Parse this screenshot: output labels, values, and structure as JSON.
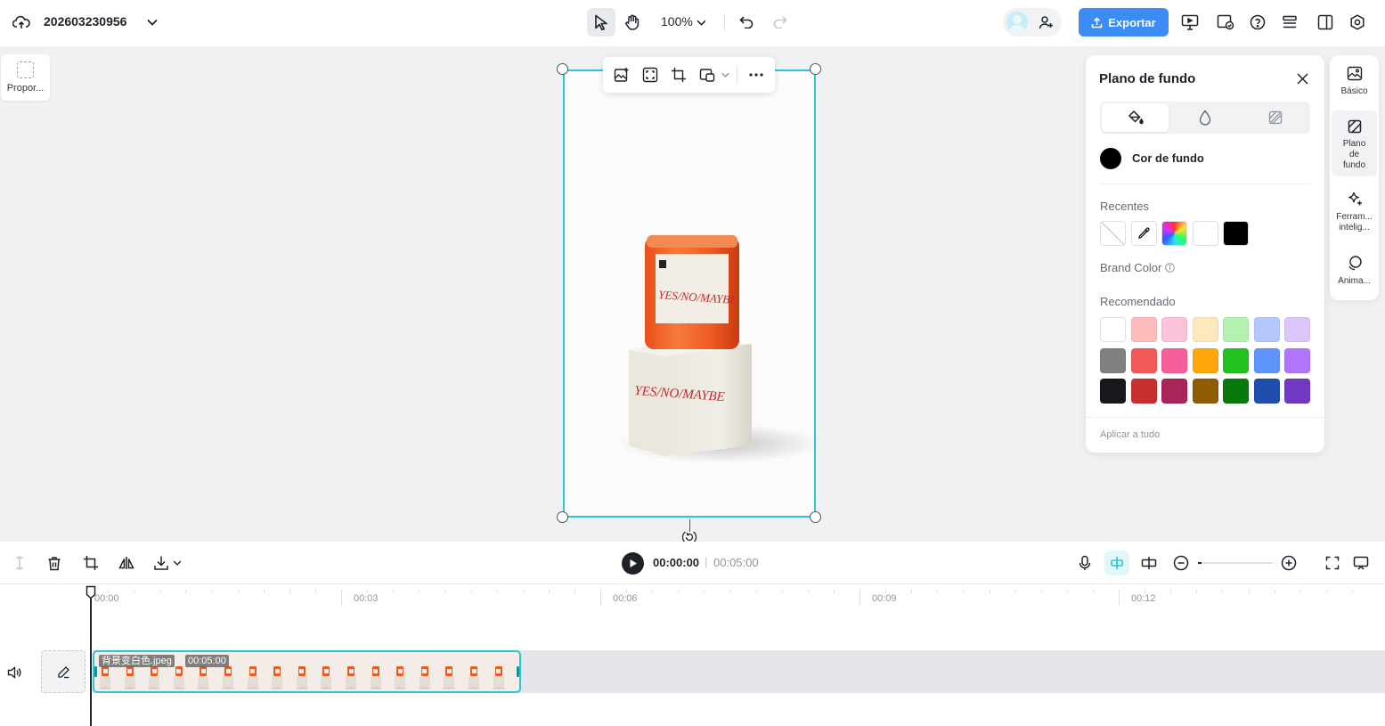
{
  "topbar": {
    "project_title": "202603230956",
    "zoom": "100%",
    "export_label": "Exportar"
  },
  "canvas": {
    "ratio_label": "Propor..."
  },
  "background_panel": {
    "title": "Plano de fundo",
    "color_label": "Cor de fundo",
    "current_color": "#000000",
    "recent_label": "Recentes",
    "recent_colors": [
      "transparent",
      "eyedropper",
      "spectrum",
      "#ffffff",
      "#000000"
    ],
    "brand_label": "Brand Color",
    "recommended_label": "Recomendado",
    "recommended_colors": [
      [
        "#ffffff",
        "#fdbbbb",
        "#fbc3d9",
        "#fde7bc",
        "#b5f1b1",
        "#b4c8fd",
        "#dcc6fb"
      ],
      [
        "#808080",
        "#f2595a",
        "#f75f9a",
        "#fea70c",
        "#22c120",
        "#5e94fc",
        "#b075fb"
      ],
      [
        "#17181c",
        "#c82f2f",
        "#a8255c",
        "#8f5b04",
        "#087a0c",
        "#1f4ead",
        "#7138c1"
      ]
    ],
    "apply_all_label": "Aplicar a tudo"
  },
  "right_rail": {
    "items": [
      {
        "label": "Básico",
        "icon": "image-icon"
      },
      {
        "label": "Plano de fundo",
        "icon": "background-icon"
      },
      {
        "label": "Ferram... intelig...",
        "icon": "sparkle-icon"
      },
      {
        "label": "Anima...",
        "icon": "animation-icon"
      }
    ]
  },
  "timeline": {
    "current_time": "00:00:00",
    "total_time": "00:05:00",
    "ruler_labels": [
      "00:00",
      "00:03",
      "00:06",
      "00:09",
      "00:12"
    ],
    "clip": {
      "filename": "背景变白色.jpeg",
      "duration": "00:05:00"
    }
  },
  "colors": {
    "accent": "#30c3d1",
    "export": "#3b8cf5"
  }
}
